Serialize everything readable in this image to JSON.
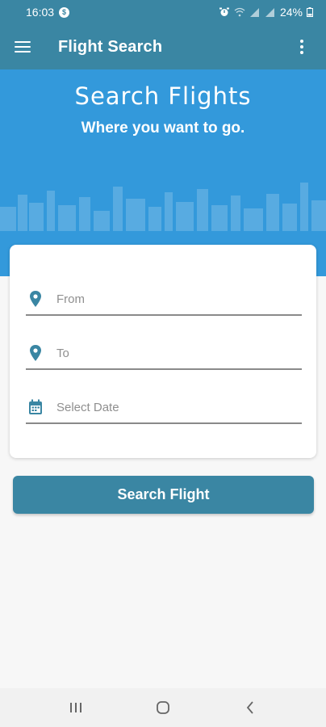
{
  "status_bar": {
    "time": "16:03",
    "coin_glyph": "$",
    "battery": "24%"
  },
  "app_bar": {
    "title": "Flight Search",
    "menu_icon": "hamburger-menu-icon",
    "overflow_icon": "more-vert-icon"
  },
  "hero": {
    "title": "Search Flights",
    "subtitle": "Where you want to go."
  },
  "form": {
    "from": {
      "placeholder": "From",
      "value": "",
      "icon": "location-pin-icon"
    },
    "to": {
      "placeholder": "To",
      "value": "",
      "icon": "location-pin-icon"
    },
    "date": {
      "placeholder": "Select Date",
      "value": "",
      "icon": "calendar-icon"
    }
  },
  "actions": {
    "search_label": "Search Flight"
  },
  "colors": {
    "primary": "#3a86a3",
    "hero": "#3399db",
    "background": "#f7f7f7"
  }
}
